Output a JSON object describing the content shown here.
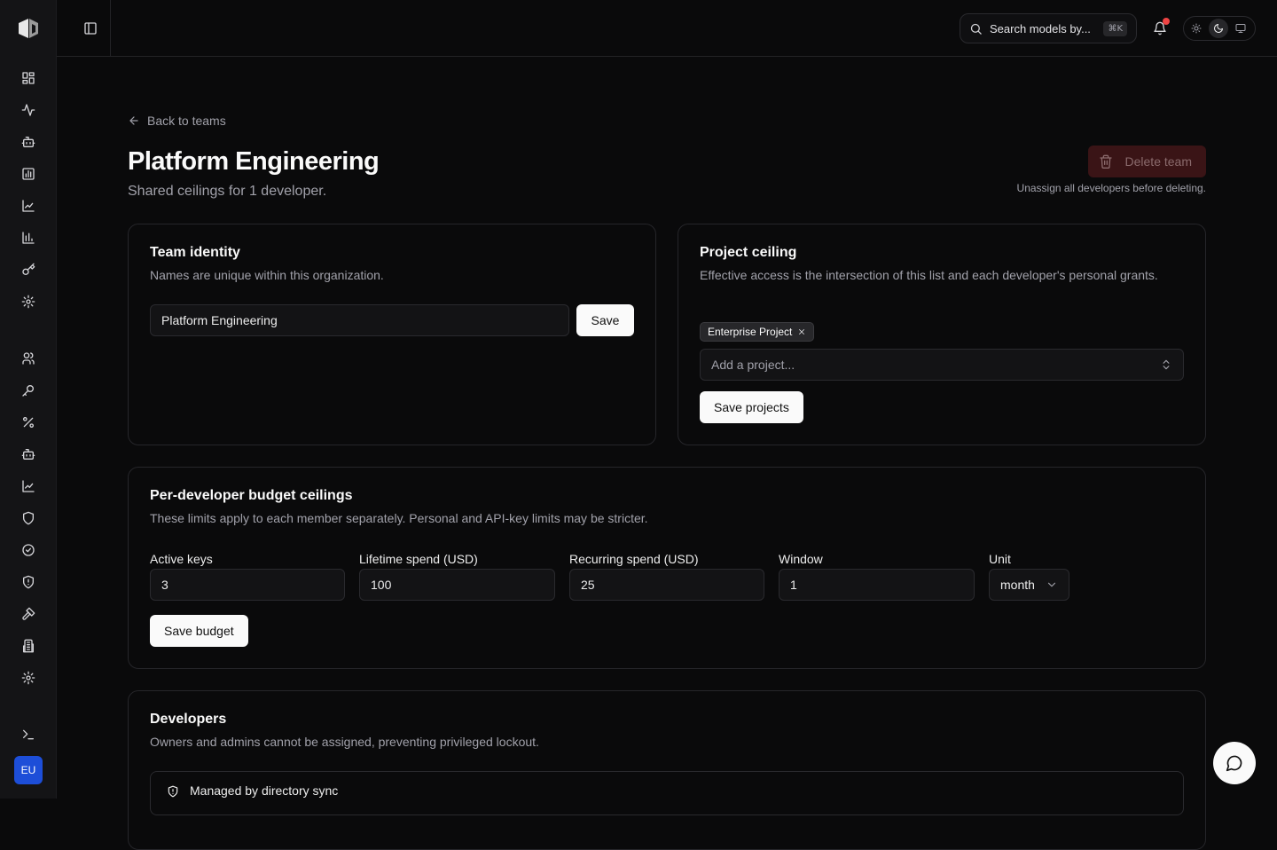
{
  "topbar": {
    "search_text": "Search models by...",
    "search_shortcut": "⌘K",
    "notification_color": "#ef4444",
    "theme_options": [
      "sun-icon",
      "moon-icon",
      "monitor-icon"
    ],
    "theme_active": "moon-icon"
  },
  "sidebar": {
    "logo": "logo-icon",
    "items": [
      {
        "name": "dashboard",
        "icon": "grid-icon"
      },
      {
        "name": "activity",
        "icon": "activity-icon"
      },
      {
        "name": "models",
        "icon": "bot-icon"
      },
      {
        "name": "analytics",
        "icon": "bar-chart-icon"
      },
      {
        "name": "trends",
        "icon": "line-chart-icon"
      },
      {
        "name": "usage",
        "icon": "bar-chart-2-icon"
      },
      {
        "name": "keys",
        "icon": "key-icon"
      },
      {
        "name": "settings",
        "icon": "gear-icon"
      },
      {
        "name": "team-members",
        "icon": "users-icon"
      },
      {
        "name": "api-keys",
        "icon": "key-round-icon"
      },
      {
        "name": "discounts",
        "icon": "percent-icon"
      },
      {
        "name": "agents",
        "icon": "bot-icon"
      },
      {
        "name": "reports",
        "icon": "line-chart-icon"
      },
      {
        "name": "security",
        "icon": "shield-icon"
      },
      {
        "name": "compliance",
        "icon": "badge-check-icon"
      },
      {
        "name": "policies",
        "icon": "shield-alert-icon"
      },
      {
        "name": "tools",
        "icon": "hammer-icon"
      },
      {
        "name": "organization",
        "icon": "building-icon"
      },
      {
        "name": "admin-settings",
        "icon": "gear-icon"
      },
      {
        "name": "terminal",
        "icon": "terminal-icon"
      }
    ],
    "avatar_initials": "EU",
    "avatar_color": "#1d4ed8"
  },
  "header": {
    "back_label": "Back to teams",
    "title": "Platform Engineering",
    "subtitle": "Shared ceilings for 1 developer.",
    "delete_label": "Delete team",
    "delete_hint": "Unassign all developers before deleting."
  },
  "team_identity": {
    "title": "Team identity",
    "description": "Names are unique within this organization.",
    "name_value": "Platform Engineering",
    "save_label": "Save"
  },
  "project_ceiling": {
    "title": "Project ceiling",
    "description": "Effective access is the intersection of this list and each developer's personal grants.",
    "tags": [
      "Enterprise Project"
    ],
    "add_placeholder": "Add a project...",
    "save_label": "Save projects"
  },
  "budget": {
    "title": "Per-developer budget ceilings",
    "description": "These limits apply to each member separately. Personal and API-key limits may be stricter.",
    "fields": [
      {
        "label": "Active keys",
        "value": "3"
      },
      {
        "label": "Lifetime spend (USD)",
        "value": "100"
      },
      {
        "label": "Recurring spend (USD)",
        "value": "25"
      },
      {
        "label": "Window",
        "value": "1"
      }
    ],
    "unit_label": "Unit",
    "unit_value": "month",
    "save_label": "Save budget"
  },
  "developers": {
    "title": "Developers",
    "description": "Owners and admins cannot be assigned, preventing privileged lockout.",
    "sync_label": "Managed by directory sync"
  }
}
